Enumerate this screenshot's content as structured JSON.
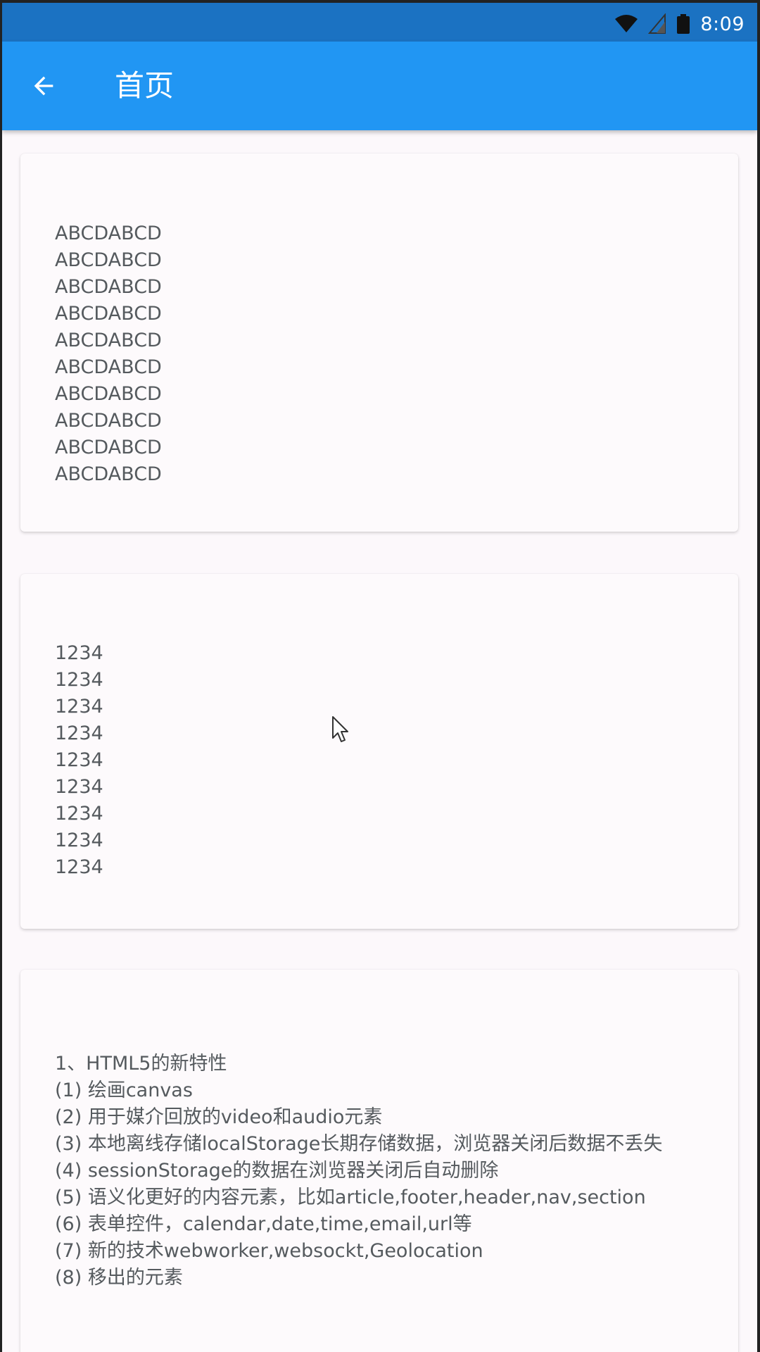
{
  "status_bar": {
    "time": "8:09",
    "icons": [
      "wifi-icon",
      "signal-icon",
      "battery-icon"
    ]
  },
  "app_bar": {
    "title": "首页",
    "back_icon": "arrow-back-icon",
    "color": "#2196f3"
  },
  "cards": [
    {
      "lines": [
        "ABCDABCD",
        "ABCDABCD",
        "ABCDABCD",
        "ABCDABCD",
        "ABCDABCD",
        "ABCDABCD",
        "ABCDABCD",
        "ABCDABCD",
        "ABCDABCD",
        "ABCDABCD"
      ]
    },
    {
      "lines": [
        "1234",
        "1234",
        "1234",
        "1234",
        "1234",
        "1234",
        "1234",
        "1234",
        "1234"
      ]
    },
    {
      "lines": [
        "1、HTML5的新特性",
        "(1) 绘画canvas",
        "(2) 用于媒介回放的video和audio元素",
        "(3) 本地离线存储localStorage长期存储数据，浏览器关闭后数据不丢失",
        "(4) sessionStorage的数据在浏览器关闭后自动删除",
        "(5) 语义化更好的内容元素，比如article,footer,header,nav,section",
        "(6) 表单控件，calendar,date,time,email,url等",
        "(7) 新的技术webworker,websockt,Geolocation",
        "(8) 移出的元素"
      ]
    }
  ]
}
